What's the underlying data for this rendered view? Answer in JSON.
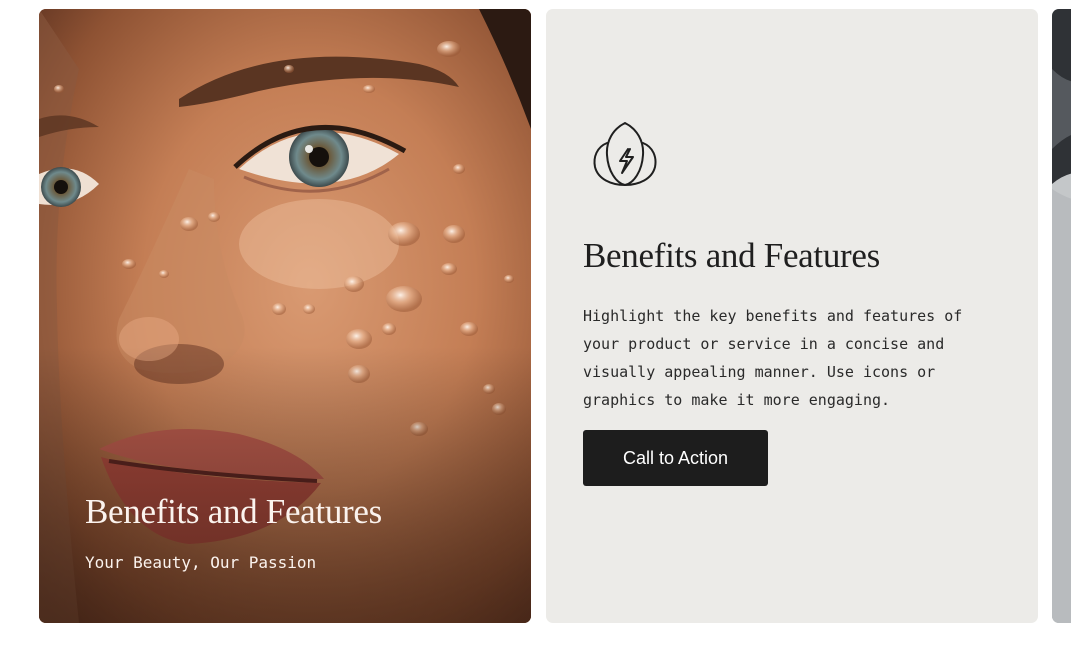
{
  "cards": [
    {
      "title": "Benefits and Features",
      "subtitle": "Your Beauty, Our Passion"
    },
    {
      "icon": "lotus-lightning-icon",
      "title": "Benefits and Features",
      "body": "Highlight the key benefits and features of your product or service in a concise and visually appealing manner. Use icons or graphics to make it more engaging.",
      "cta_label": "Call to Action"
    }
  ],
  "colors": {
    "feature_card_bg": "#ecebe8",
    "button_bg": "#1d1d1d",
    "photo_text": "#fbf3ee"
  }
}
